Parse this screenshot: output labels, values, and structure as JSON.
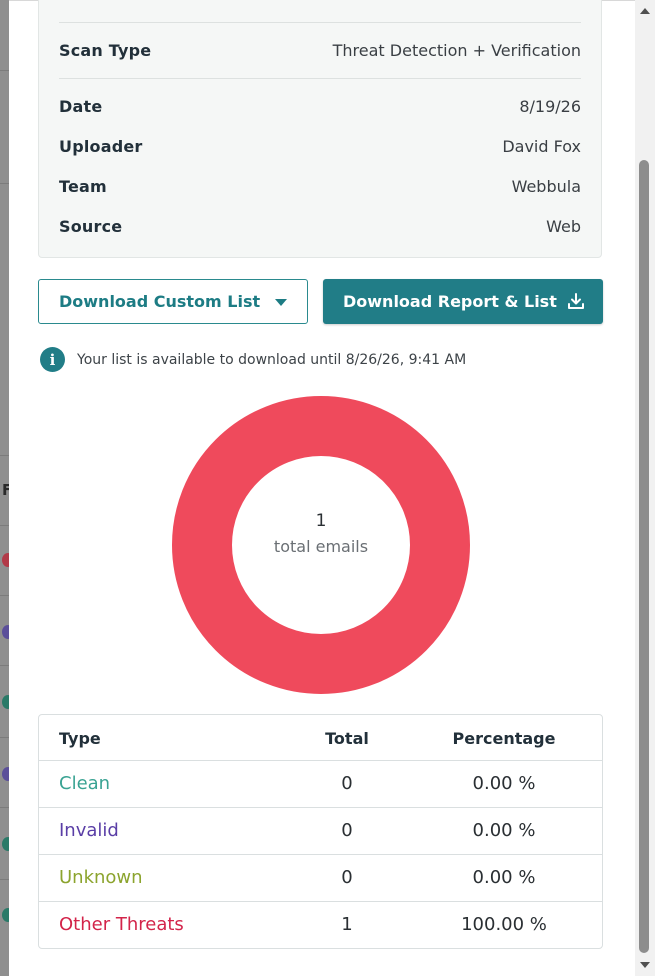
{
  "scan_details": [
    {
      "key": "Scan Type",
      "value": "Threat Detection + Verification"
    },
    {
      "key": "Date",
      "value": "8/19/26"
    },
    {
      "key": "Uploader",
      "value": "David Fox"
    },
    {
      "key": "Team",
      "value": "Webbula"
    },
    {
      "key": "Source",
      "value": "Web"
    }
  ],
  "actions": {
    "download_custom_list": "Download Custom List",
    "download_report_list": "Download Report & List"
  },
  "notice": "Your list is available to download until 8/26/26, 9:41 AM",
  "summary": {
    "total": "1",
    "total_label": "total emails"
  },
  "chart_data": {
    "type": "pie",
    "categories": [
      "Clean",
      "Invalid",
      "Unknown",
      "Other Threats"
    ],
    "values": [
      0,
      0,
      0,
      1
    ],
    "colors": [
      "#3aa393",
      "#5a3ea6",
      "#8ca42e",
      "#ef4a5c"
    ]
  },
  "table": {
    "headers": {
      "type": "Type",
      "total": "Total",
      "percentage": "Percentage"
    },
    "rows": [
      {
        "type": "Clean",
        "total": "0",
        "percentage": "0.00 %",
        "color": "#3aa393"
      },
      {
        "type": "Invalid",
        "total": "0",
        "percentage": "0.00 %",
        "color": "#5a3ea6"
      },
      {
        "type": "Unknown",
        "total": "0",
        "percentage": "0.00 %",
        "color": "#8ca42e"
      },
      {
        "type": "Other Threats",
        "total": "1",
        "percentage": "100.00 %",
        "color": "#d3244a"
      }
    ]
  },
  "backdrop_fragment": "F"
}
